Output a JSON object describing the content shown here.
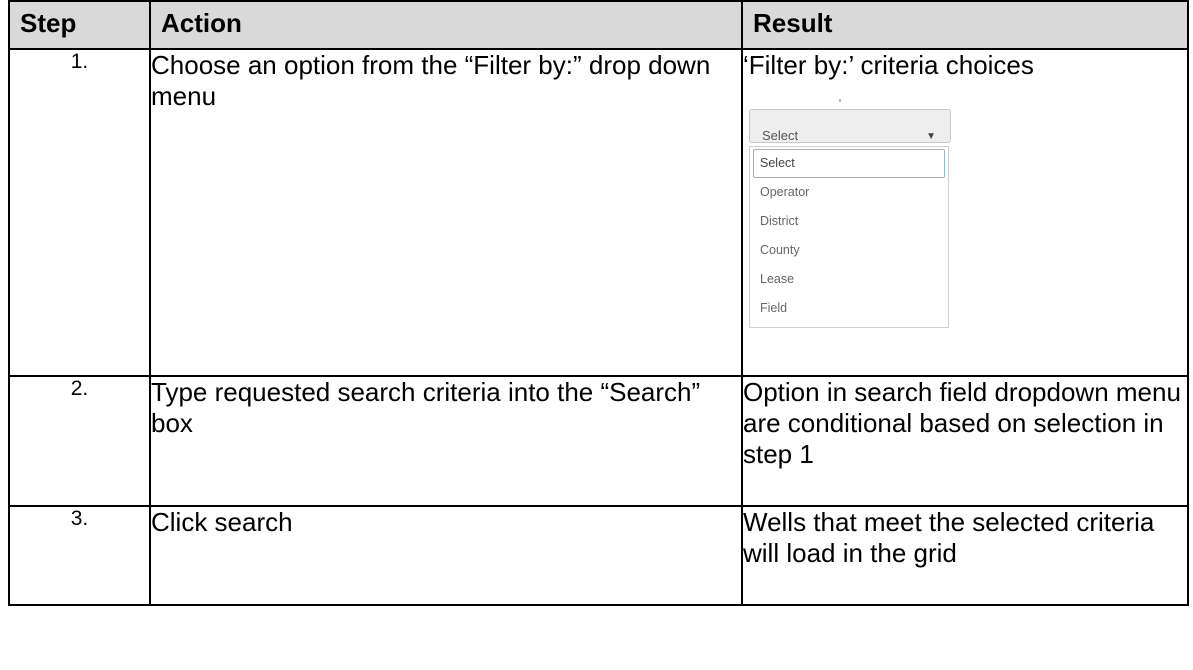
{
  "table": {
    "headers": [
      "Step",
      "Action",
      "Result"
    ],
    "rows": [
      {
        "step": "1.",
        "action": "Choose an option from the “Filter by:” drop down menu",
        "result": "‘Filter by:’ criteria choices"
      },
      {
        "step": "2.",
        "action": "Type requested search criteria into the “Search” box",
        "result": "Option in search field dropdown menu are conditional based on selection in step 1"
      },
      {
        "step": "3.",
        "action": "Click search",
        "result": "Wells that meet the selected criteria will load in the grid"
      }
    ]
  },
  "dropdown": {
    "selected": "Select",
    "caret_icon": "caret-down-icon",
    "options": [
      "Select",
      "Operator",
      "District",
      "County",
      "Lease",
      "Field"
    ]
  }
}
